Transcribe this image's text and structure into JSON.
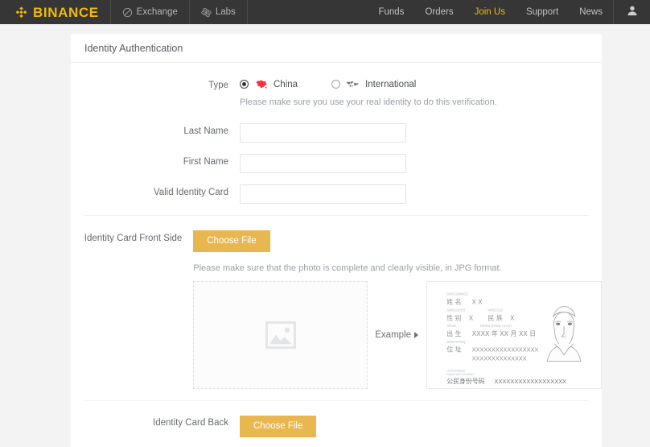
{
  "header": {
    "brand": "BINANCE",
    "brand_icon": "binance-diamond-logo",
    "left_nav": [
      {
        "label": "Exchange",
        "icon": "exchange-circle-slash-icon"
      },
      {
        "label": "Labs",
        "icon": "labs-atom-icon"
      }
    ],
    "right_nav": [
      {
        "label": "Funds",
        "accent": false
      },
      {
        "label": "Orders",
        "accent": false
      },
      {
        "label": "Join Us",
        "accent": true
      },
      {
        "label": "Support",
        "accent": false
      },
      {
        "label": "News",
        "accent": false
      }
    ],
    "user_icon": "user-avatar-icon",
    "accent_color": "#f0b90b",
    "background_color": "#363636"
  },
  "card": {
    "title": "Identity Authentication"
  },
  "type_section": {
    "label": "Type",
    "options": [
      {
        "label": "China",
        "icon": "china-map-icon",
        "selected": true,
        "icon_color": "#f5333f"
      },
      {
        "label": "International",
        "icon": "world-map-icon",
        "selected": false,
        "icon_color": "#6e757b"
      }
    ],
    "hint": "Please make sure you use your real identity to do this verification."
  },
  "fields": [
    {
      "label": "Last Name",
      "value": "",
      "placeholder": ""
    },
    {
      "label": "First Name",
      "value": "",
      "placeholder": ""
    },
    {
      "label": "Valid Identity Card",
      "value": "",
      "placeholder": ""
    }
  ],
  "front_upload": {
    "label": "Identity Card Front Side",
    "button_label": "Choose File",
    "hint": "Please make sure that the photo is complete and clearly visible, in JPG format.",
    "dropzone_icon": "image-placeholder-icon",
    "example_label": "Example",
    "example_caret_icon": "caret-right-icon"
  },
  "id_card_example": {
    "rows": [
      {
        "pinyin": "SINGGMINGZ",
        "cn": "姓 名",
        "value": "X  X"
      },
      {
        "pinyin_left": "SINGGSIEO",
        "cn_left": "性 别",
        "value_left": "X",
        "pinyin_right": "MINZCUZ",
        "cn_right": "民 族",
        "value_right": "X"
      },
      {
        "pinyin": "SENG",
        "cn": "出  生",
        "value": "XXXX 年 XX 月 XX 日",
        "pinyin_extra": "NINNZ  NYIED  HAUH"
      },
      {
        "pinyin": "DIWGYOUQ",
        "cn": "住  址",
        "value": "XXXXXXXXXXXXXXXXX",
        "value2": "XXXXXXXXXXXXXX"
      }
    ],
    "id_number": {
      "pinyin": "GUNGHMINZ SINHFWN HAUMAJ",
      "cn": "公民身份号码",
      "value": "XXXXXXXXXXXXXXXXXX"
    },
    "portrait_icon": "person-portrait-line-art"
  },
  "back_upload": {
    "label": "Identity Card Back",
    "button_label": "Choose File"
  }
}
